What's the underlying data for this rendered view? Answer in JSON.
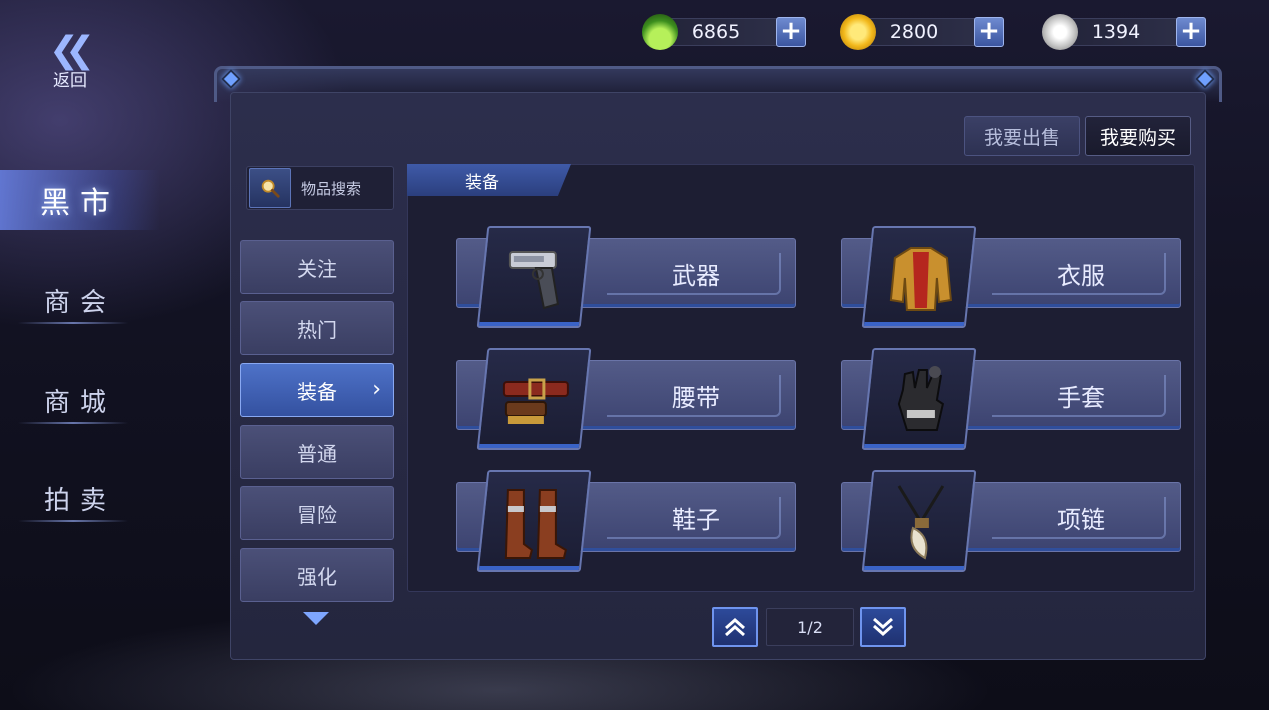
{
  "currencies": [
    {
      "name": "gem",
      "amount": "6865",
      "icon": "green-gem-icon"
    },
    {
      "name": "gold",
      "amount": "2800",
      "icon": "gold-coin-icon"
    },
    {
      "name": "silver",
      "amount": "1394",
      "icon": "silver-coin-icon"
    }
  ],
  "back": {
    "label": "返回"
  },
  "left_nav": {
    "items": [
      {
        "label": "黑市",
        "active": true
      },
      {
        "label": "商会",
        "active": false
      },
      {
        "label": "商城",
        "active": false
      },
      {
        "label": "拍卖",
        "active": false
      }
    ]
  },
  "trade_tabs": {
    "sell": "我要出售",
    "buy": "我要购买",
    "active": "buy"
  },
  "search": {
    "label": "物品搜索"
  },
  "categories": {
    "items": [
      {
        "label": "关注",
        "active": false
      },
      {
        "label": "热门",
        "active": false
      },
      {
        "label": "装备",
        "active": true
      },
      {
        "label": "普通",
        "active": false
      },
      {
        "label": "冒险",
        "active": false
      },
      {
        "label": "强化",
        "active": false
      }
    ]
  },
  "section": {
    "title": "装备"
  },
  "equipment": [
    {
      "label": "武器",
      "icon": "pistol-icon"
    },
    {
      "label": "衣服",
      "icon": "jacket-icon"
    },
    {
      "label": "腰带",
      "icon": "belt-icon"
    },
    {
      "label": "手套",
      "icon": "glove-icon"
    },
    {
      "label": "鞋子",
      "icon": "boots-icon"
    },
    {
      "label": "项链",
      "icon": "necklace-icon"
    }
  ],
  "pager": {
    "page": "1/2"
  },
  "colors": {
    "accent": "#4e72c8",
    "panel": "#2c2e4c",
    "highlight": "#89a8f2"
  }
}
